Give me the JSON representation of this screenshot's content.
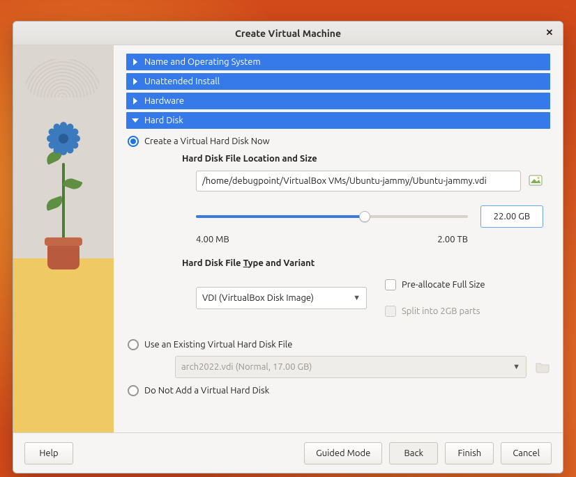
{
  "dialog": {
    "title": "Create Virtual Machine"
  },
  "sections": {
    "name_os": "Name and Operating System",
    "unattended": "Unattended Install",
    "hardware": "Hardware",
    "hard_disk": "Hard Disk"
  },
  "hard_disk": {
    "create_now": "Create a Virtual Hard Disk Now",
    "location_size_title": "Hard Disk File Location and Size",
    "file_path": "/home/debugpoint/VirtualBox VMs/Ubuntu-jammy/Ubuntu-jammy.vdi",
    "size_value": "22.00 GB",
    "slider_min": "4.00 MB",
    "slider_max": "2.00 TB",
    "slider_fill_pct": 62,
    "type_variant_title": "Hard Disk File Type and Variant",
    "disk_type_selected": "VDI (VirtualBox Disk Image)",
    "preallocate": "Pre-allocate Full Size",
    "split_2gb": "Split into 2GB parts",
    "use_existing": "Use an Existing Virtual Hard Disk File",
    "existing_selected": "arch2022.vdi (Normal, 17.00 GB)",
    "do_not_add": "Do Not Add a Virtual Hard Disk"
  },
  "footer": {
    "help": "Help",
    "guided": "Guided Mode",
    "back": "Back",
    "finish": "Finish",
    "cancel": "Cancel"
  }
}
